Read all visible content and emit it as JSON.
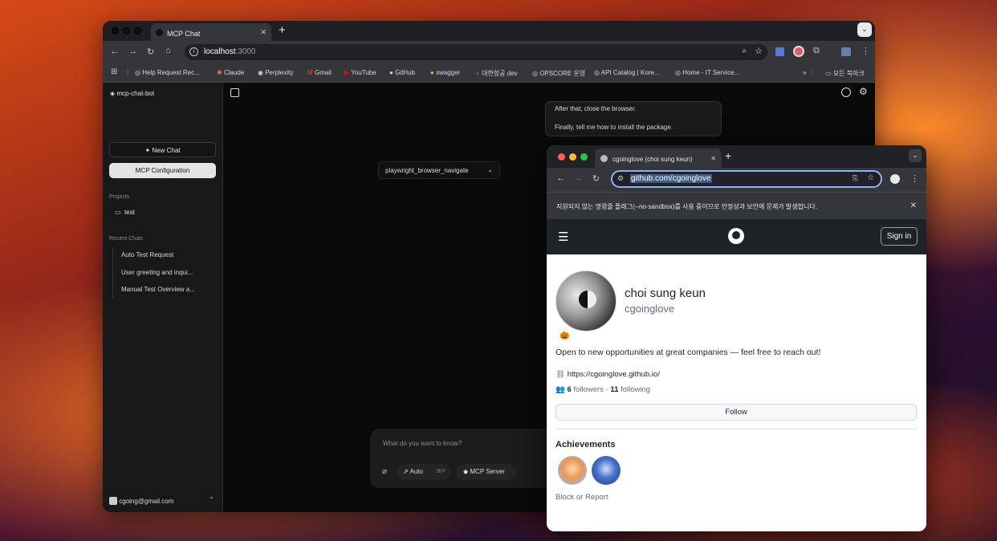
{
  "browser": {
    "tab_title": "MCP Chat",
    "url_host": "localhost",
    "url_port": ":3000",
    "bookmarks": [
      "Help Request Rec...",
      "Claude",
      "Perplexity",
      "Gmail",
      "YouTube",
      "GitHub",
      "swagger",
      "대한항공 dev",
      "OPSCORE 운영",
      "API Catalog | Kore...",
      "Home - IT Service..."
    ],
    "bookmarks_all": "모든 북마크"
  },
  "sidebar": {
    "brand": "mcp-chat-bot",
    "new_chat": "New Chat",
    "mcp_config": "MCP Configuration",
    "projects_title": "Projects",
    "projects": [
      "test"
    ],
    "recent_title": "Recent Chats",
    "recent": [
      "Auto Test Request",
      "User greeting and inqui...",
      "Manual Test Overview a..."
    ],
    "user_email": "cgoing@gmail.com"
  },
  "chat": {
    "message_lines": [
      "After that, close the browser.",
      "Finally, tell me how to install the package."
    ],
    "tool_badge": "playwright_browser_navigate",
    "input_placeholder": "What do you want to know?",
    "mode_label": "Auto",
    "shortcut": "⌘P",
    "mcp_server": "MCP Server"
  },
  "github_window": {
    "tab_title": "cgoinglove (choi sung keun)",
    "url": "github.com/cgoinglove",
    "info_bar": "지원되지 않는 명령줄 플래그(--no-sandbox)를 사용 중이므로 안정성과 보안에 문제가 발생합니다.",
    "sign_in": "Sign in",
    "name": "choi sung keun",
    "username": "cgoinglove",
    "status_emoji": "🎃",
    "bio": "Open to new opportunities at great companies — feel free to reach out!",
    "website": "https://cgoinglove.github.io/",
    "followers_count": "6",
    "followers_label": "followers",
    "separator": "·",
    "following_count": "11",
    "following_label": "following",
    "follow_button": "Follow",
    "achievements_title": "Achievements",
    "block_report": "Block or Report"
  },
  "colors": {
    "github_header": "#1f2328",
    "omnibox_focus": "#8ab4f8",
    "url_highlight": "#3d5a8a"
  }
}
